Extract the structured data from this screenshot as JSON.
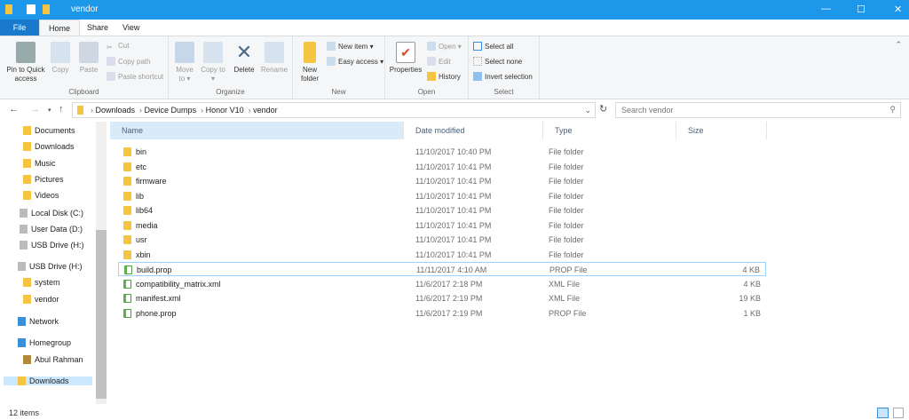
{
  "window": {
    "title": "vendor",
    "minimize": "—",
    "maximize": "☐",
    "close": "✕"
  },
  "tabs": [
    "File",
    "Home",
    "Share",
    "View"
  ],
  "ribbon": {
    "clipboard": {
      "label": "Clipboard",
      "pin": "Pin to Quick access",
      "copy": "Copy",
      "paste": "Paste",
      "cut": "Cut",
      "copy_path": "Copy path",
      "paste_shortcut": "Paste shortcut"
    },
    "organize": {
      "label": "Organize",
      "move_to": "Move to ▾",
      "copy_to": "Copy to ▾",
      "delete": "Delete",
      "rename": "Rename"
    },
    "new": {
      "label": "New",
      "new_folder": "New folder",
      "new_item": "New item ▾",
      "easy_access": "Easy access ▾"
    },
    "open": {
      "label": "Open",
      "properties": "Properties",
      "open": "Open ▾",
      "edit": "Edit",
      "history": "History"
    },
    "select": {
      "label": "Select",
      "select_all": "Select all",
      "select_none": "Select none",
      "invert": "Invert selection"
    }
  },
  "address": {
    "breadcrumbs": [
      "Downloads",
      "Device Dumps",
      "Honor V10",
      "vendor"
    ],
    "search_placeholder": "Search vendor"
  },
  "nav": [
    "Documents",
    "Downloads",
    "Music",
    "Pictures",
    "Videos",
    "Local Disk (C:)",
    "User Data (D:)",
    "USB Drive (H:)",
    "USB Drive (H:)",
    "system",
    "vendor",
    "Network",
    "Homegroup",
    "Abul Rahman",
    "Downloads"
  ],
  "columns": [
    "Name",
    "Date modified",
    "Type",
    "Size"
  ],
  "files": [
    {
      "name": "bin",
      "date": "11/10/2017 10:40 PM",
      "type": "File folder",
      "size": "",
      "kind": "folder"
    },
    {
      "name": "etc",
      "date": "11/10/2017 10:41 PM",
      "type": "File folder",
      "size": "",
      "kind": "folder"
    },
    {
      "name": "firmware",
      "date": "11/10/2017 10:41 PM",
      "type": "File folder",
      "size": "",
      "kind": "folder"
    },
    {
      "name": "lib",
      "date": "11/10/2017 10:41 PM",
      "type": "File folder",
      "size": "",
      "kind": "folder"
    },
    {
      "name": "lib64",
      "date": "11/10/2017 10:41 PM",
      "type": "File folder",
      "size": "",
      "kind": "folder"
    },
    {
      "name": "media",
      "date": "11/10/2017 10:41 PM",
      "type": "File folder",
      "size": "",
      "kind": "folder"
    },
    {
      "name": "usr",
      "date": "11/10/2017 10:41 PM",
      "type": "File folder",
      "size": "",
      "kind": "folder"
    },
    {
      "name": "xbin",
      "date": "11/10/2017 10:41 PM",
      "type": "File folder",
      "size": "",
      "kind": "folder"
    },
    {
      "name": "build.prop",
      "date": "11/11/2017 4:10 AM",
      "type": "PROP File",
      "size": "4 KB",
      "kind": "file",
      "selected": true
    },
    {
      "name": "compatibility_matrix.xml",
      "date": "11/6/2017 2:18 PM",
      "type": "XML File",
      "size": "4 KB",
      "kind": "file"
    },
    {
      "name": "manifest.xml",
      "date": "11/6/2017 2:19 PM",
      "type": "XML File",
      "size": "19 KB",
      "kind": "file"
    },
    {
      "name": "phone.prop",
      "date": "11/6/2017 2:19 PM",
      "type": "PROP File",
      "size": "1 KB",
      "kind": "file"
    }
  ],
  "status": {
    "count": "12 items"
  },
  "colors": {
    "titlebar": "#1c97ea",
    "file_tab": "#1979ca",
    "header_bg": "#d9ebf9",
    "folder": "#f5c542"
  }
}
